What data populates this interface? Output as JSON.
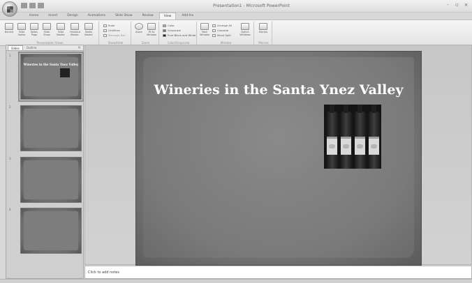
{
  "app": {
    "title": "Presentation1 - Microsoft PowerPoint",
    "window_controls": [
      "-",
      "▫",
      "×"
    ]
  },
  "ribbon": {
    "tabs": [
      "Home",
      "Insert",
      "Design",
      "Animations",
      "Slide Show",
      "Review",
      "View",
      "Add-Ins"
    ],
    "active_tab": "View",
    "groups": {
      "presentation_views": {
        "label": "Presentation Views",
        "buttons": [
          "Normal",
          "Slide Sorter",
          "Notes Page",
          "Slide Show",
          "Slide Master",
          "Handout Master",
          "Notes Master"
        ]
      },
      "show_hide": {
        "label": "Show/Hide",
        "options": [
          "Ruler",
          "Gridlines",
          "Message Bar"
        ]
      },
      "zoom": {
        "label": "Zoom",
        "buttons": [
          "Zoom",
          "Fit to Window"
        ]
      },
      "color_grayscale": {
        "label": "Color/Grayscale",
        "options": [
          "Color",
          "Grayscale",
          "Pure Black and White"
        ]
      },
      "window": {
        "label": "Window",
        "buttons": [
          "New Window",
          "Switch Windows"
        ],
        "options": [
          "Arrange All",
          "Cascade",
          "Move Split"
        ]
      },
      "macros": {
        "label": "Macros",
        "buttons": [
          "Macros"
        ]
      }
    }
  },
  "slides_panel": {
    "tabs": [
      "Slides",
      "Outline"
    ],
    "active_tab": "Slides",
    "close_glyph": "×",
    "thumbnails": [
      {
        "number": "1",
        "title": "Wineries in the Santa Ynez Valley",
        "selected": true
      },
      {
        "number": "2",
        "title": "",
        "selected": false
      },
      {
        "number": "3",
        "title": "",
        "selected": false
      },
      {
        "number": "4",
        "title": "",
        "selected": false
      }
    ]
  },
  "slide": {
    "title": "Wineries in the Santa Ynez Valley",
    "picture_icon": "wine-bottles-photo"
  },
  "notes": {
    "placeholder": "Click to add notes"
  }
}
